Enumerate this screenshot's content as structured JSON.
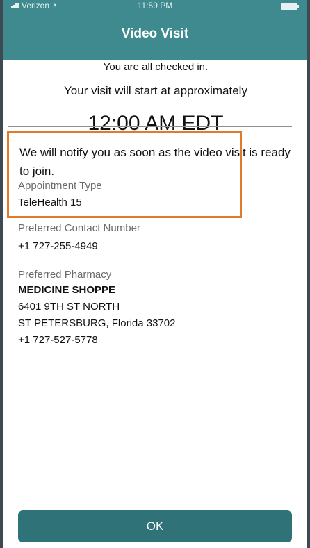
{
  "status_bar": {
    "carrier": "Verizon",
    "time": "11:59 PM"
  },
  "header": {
    "title": "Video Visit"
  },
  "visit": {
    "checked_in": "You are all checked in.",
    "start_line": "Your visit will start at approximately",
    "time": "12:00 AM EDT",
    "notify": "We will notify you as soon as the video visit is ready to join."
  },
  "appointment": {
    "type_label": "Appointment Type",
    "type_value": "TeleHealth 15",
    "contact_label": "Preferred Contact Number",
    "contact_value": "+1 727-255-4949"
  },
  "pharmacy": {
    "label": "Preferred Pharmacy",
    "name": "MEDICINE SHOPPE",
    "address_line1": "6401 9TH ST NORTH",
    "address_line2": "ST PETERSBURG, Florida  33702",
    "phone": "+1 727-527-5778"
  },
  "footer": {
    "ok_label": "OK"
  },
  "colors": {
    "header_bg": "#3f8a8f",
    "button_bg": "#2f7378",
    "highlight_border": "#e07b2c"
  }
}
